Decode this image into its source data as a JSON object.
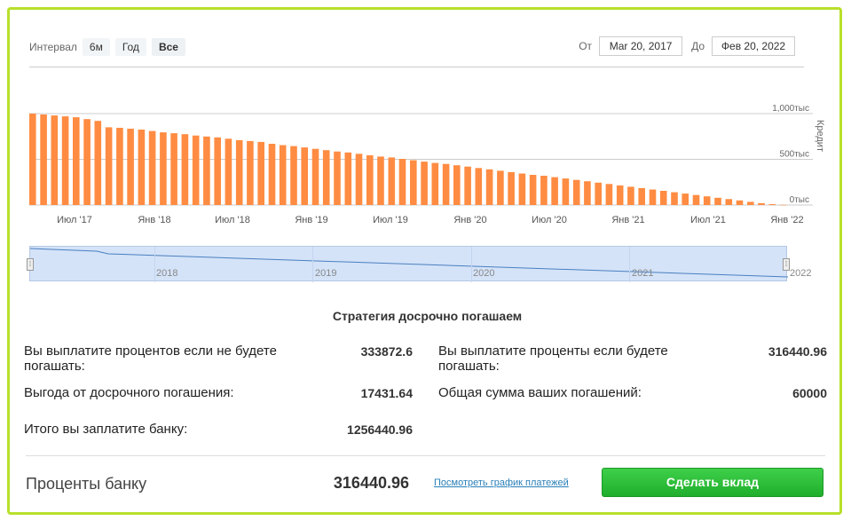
{
  "controls": {
    "interval_label": "Интервал",
    "interval_buttons": [
      "6м",
      "Год",
      "Все"
    ],
    "active_interval": "Все",
    "from_label": "От",
    "from_value": "Mar 20, 2017",
    "to_label": "До",
    "to_value": "Фев 20, 2022"
  },
  "chart_data": {
    "type": "bar",
    "ylabel": "Кредит",
    "ytick_labels": [
      "1,000тыс",
      "500тыс",
      "0тыс"
    ],
    "ylim": [
      0,
      1000000
    ],
    "xtick_labels": [
      "Июл '17",
      "Янв '18",
      "Июл '18",
      "Янв '19",
      "Июл '19",
      "Янв '20",
      "Июл '20",
      "Янв '21",
      "Июл '21",
      "Янв '22"
    ],
    "values": [
      1000000,
      990000,
      980000,
      970000,
      960000,
      940000,
      920000,
      850000,
      845000,
      835000,
      825000,
      810000,
      795000,
      785000,
      775000,
      760000,
      750000,
      740000,
      725000,
      710000,
      700000,
      690000,
      670000,
      655000,
      645000,
      630000,
      615000,
      600000,
      585000,
      575000,
      560000,
      545000,
      530000,
      520000,
      505000,
      490000,
      475000,
      460000,
      450000,
      435000,
      420000,
      405000,
      390000,
      375000,
      360000,
      345000,
      330000,
      320000,
      305000,
      290000,
      275000,
      260000,
      245000,
      230000,
      215000,
      200000,
      185000,
      170000,
      155000,
      140000,
      125000,
      110000,
      95000,
      80000,
      65000,
      50000,
      35000,
      20000,
      10000,
      2000
    ],
    "bar_color": "#ff8c42",
    "grid": true
  },
  "navigator": {
    "years": [
      "2018",
      "2019",
      "2020",
      "2021",
      "2022"
    ],
    "line_color": "#4a7fc0"
  },
  "summary": {
    "title": "Стратегия досрочно погашаем",
    "interest_no_prepay_label": "Вы выплатите процентов если не будете погашать:",
    "interest_no_prepay_value": "333872.6",
    "benefit_label": "Выгода от досрочного погашения:",
    "benefit_value": "17431.64",
    "total_label": "Итого вы заплатите банку:",
    "total_value": "1256440.96",
    "interest_prepay_label": "Вы выплатите проценты если будете погашать:",
    "interest_prepay_value": "316440.96",
    "payments_sum_label": "Общая сумма ваших погашений:",
    "payments_sum_value": "60000"
  },
  "footer": {
    "bank_interest_label": "Проценты банку",
    "bank_interest_value": "316440.96",
    "schedule_link": "Посмотреть график платежей",
    "deposit_button": "Сделать вклад"
  }
}
